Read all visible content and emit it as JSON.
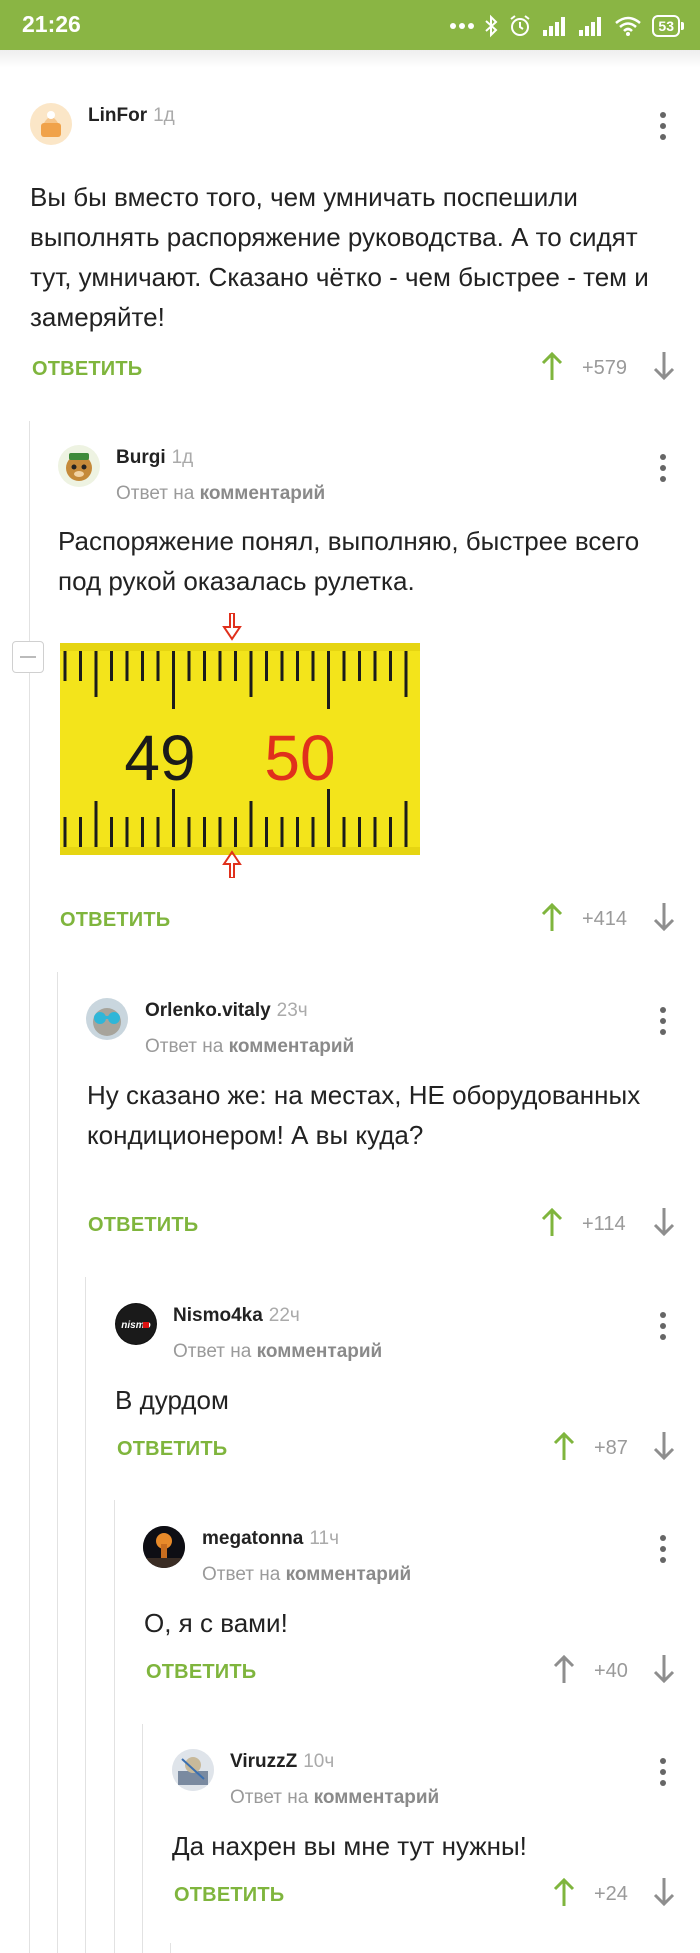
{
  "status_bar": {
    "time": "21:26",
    "battery": "53"
  },
  "colors": {
    "accent": "#8ab544",
    "reply": "#7fb53d",
    "upvote": "#7fb53d",
    "arrow_gray": "#8e8e8e"
  },
  "ruler": {
    "left_number": "49",
    "right_number": "50"
  },
  "comments": [
    {
      "username": "LinFor",
      "time": "1д",
      "reply_prefix": "",
      "reply_target": "",
      "text": "Вы бы вместо того, чем умничать поспешили выполнять распоряжение руководства. А то сидят тут, умничают. Сказано чётко - чем быстрее - тем и замеряйте!",
      "reply_label": "ОТВЕТИТЬ",
      "score": "+579",
      "upvoted": true
    },
    {
      "username": "Burgi",
      "time": "1д",
      "reply_prefix": "Ответ на",
      "reply_target": "комментарий",
      "text": "Распоряжение понял, выполняю, быстрее всего под рукой оказалась рулетка.",
      "reply_label": "ОТВЕТИТЬ",
      "score": "+414",
      "upvoted": true
    },
    {
      "username": "Orlenko.vitaly",
      "time": "23ч",
      "reply_prefix": "Ответ на",
      "reply_target": "комментарий",
      "text": "Ну сказано же: на местах, НЕ оборудованных кондиционером! А вы куда?",
      "reply_label": "ОТВЕТИТЬ",
      "score": "+114",
      "upvoted": true
    },
    {
      "username": "Nismo4ka",
      "time": "22ч",
      "reply_prefix": "Ответ на",
      "reply_target": "комментарий",
      "text": "В дурдом",
      "reply_label": "ОТВЕТИТЬ",
      "score": "+87",
      "upvoted": true
    },
    {
      "username": "megatonna",
      "time": "11ч",
      "reply_prefix": "Ответ на",
      "reply_target": "комментарий",
      "text": "О, я с вами!",
      "reply_label": "ОТВЕТИТЬ",
      "score": "+40",
      "upvoted": false
    },
    {
      "username": "ViruzzZ",
      "time": "10ч",
      "reply_prefix": "Ответ на",
      "reply_target": "комментарий",
      "text": "Да нахрен вы мне тут нужны!",
      "reply_label": "ОТВЕТИТЬ",
      "score": "+24",
      "upvoted": true
    }
  ]
}
